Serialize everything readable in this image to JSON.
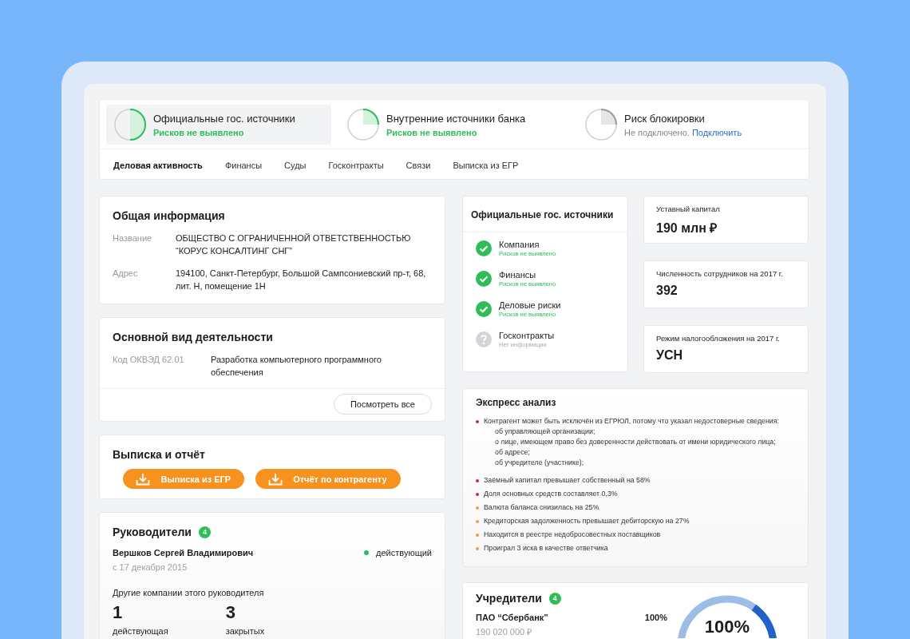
{
  "sources": [
    {
      "title": "Официальные гос. источники",
      "status": "Рисков не выявлено",
      "kind": "half",
      "selected": true
    },
    {
      "title": "Внутренние источники банка",
      "status": "Рисков не выявлено",
      "kind": "quarter",
      "selected": false
    },
    {
      "title": "Риск блокировки",
      "status": "Не подключено.",
      "link": "Подключить",
      "kind": "blocked",
      "selected": false
    }
  ],
  "tabs": [
    {
      "label": "Деловая активность",
      "selected": true
    },
    {
      "label": "Финансы",
      "selected": false
    },
    {
      "label": "Суды",
      "selected": false
    },
    {
      "label": "Госконтракты",
      "selected": false
    },
    {
      "label": "Связи",
      "selected": false
    },
    {
      "label": "Выписка из ЕГР",
      "selected": false
    }
  ],
  "general_info": {
    "title": "Общая информация",
    "fields": [
      {
        "label": "Название",
        "value": "ОБЩЕСТВО С ОГРАНИЧЕННОЙ ОТВЕТСТВЕННОСТЬЮ “КОРУС КОНСАЛТИНГ СНГ”"
      },
      {
        "label": "Адрес",
        "value": "194100, Санкт-Петербург, Большой Сампсониевский пр-т, 68, лит. Н, помещение 1Н"
      }
    ]
  },
  "main_activity": {
    "title": "Основной вид деятельности",
    "code": "Код ОКВЭД 62.01",
    "value": "Разработка компьютерного программного обеспечения",
    "button": "Посмотреть все"
  },
  "extract": {
    "title": "Выписка и отчёт",
    "buttons": [
      "Выписка из ЕГР",
      "Отчёт по контрагенту"
    ]
  },
  "leaders": {
    "title": "Руководители",
    "count": "4",
    "name": "Вершков Сергей Владимирович",
    "since": "с 17 декабря 2015",
    "status": "действующий",
    "other_title": "Другие компании этого руководителя",
    "stats": [
      {
        "value": "1",
        "label": "действующая"
      },
      {
        "value": "3",
        "label": "закрытых"
      }
    ]
  },
  "official": {
    "title": "Официальные гос. источники",
    "items": [
      {
        "title": "Компания",
        "status": "Рисков не выявлено",
        "kind": "ok"
      },
      {
        "title": "Финансы",
        "status": "Рисков не выявлено",
        "kind": "ok"
      },
      {
        "title": "Деловые риски",
        "status": "Рисков не выявлено",
        "kind": "ok"
      },
      {
        "title": "Госконтракты",
        "status": "Нет информации",
        "kind": "unknown"
      }
    ]
  },
  "stats": [
    {
      "label": "Уставный капитал",
      "value": "190 млн ₽"
    },
    {
      "label": "Численность сотрудников на 2017 г.",
      "value": "392"
    },
    {
      "label": "Режим налогообложения на 2017 г.",
      "value": "УСН"
    }
  ],
  "express": {
    "title": "Экспресс анализ",
    "items": [
      {
        "text": "Контрагент может быть исключён из ЕГРЮЛ, потому что указал недостоверные сведения:",
        "color": "#d0243c",
        "sub": [
          "об управляющей организации;",
          "о лице, имеющем право без доверенности действовать от имени юридического лица;",
          "об адресе;",
          "об учредителе (участнике);"
        ]
      },
      {
        "text": "Заёмный капитал превышает собственный на 58%",
        "color": "#d0243c"
      },
      {
        "text": "Доля основных средств составляет 0,3%",
        "color": "#d0243c"
      },
      {
        "text": "Валюта баланса снизилась на 25%",
        "color": "#f29a4a"
      },
      {
        "text": "Кредиторская задолженность превышает дебиторскую на 27%",
        "color": "#f29a4a"
      },
      {
        "text": "Находится в реестре недобросовестных поставщиков",
        "color": "#f29a4a"
      },
      {
        "text": "Проиграл 3 иска в качестве ответчика",
        "color": "#f29a4a"
      }
    ]
  },
  "founders": {
    "title": "Учредители",
    "count": "4",
    "name": "ПАО “Сбербанк”",
    "share": "100%",
    "amount": "190 020 000 ₽",
    "ring_label": "100%"
  }
}
